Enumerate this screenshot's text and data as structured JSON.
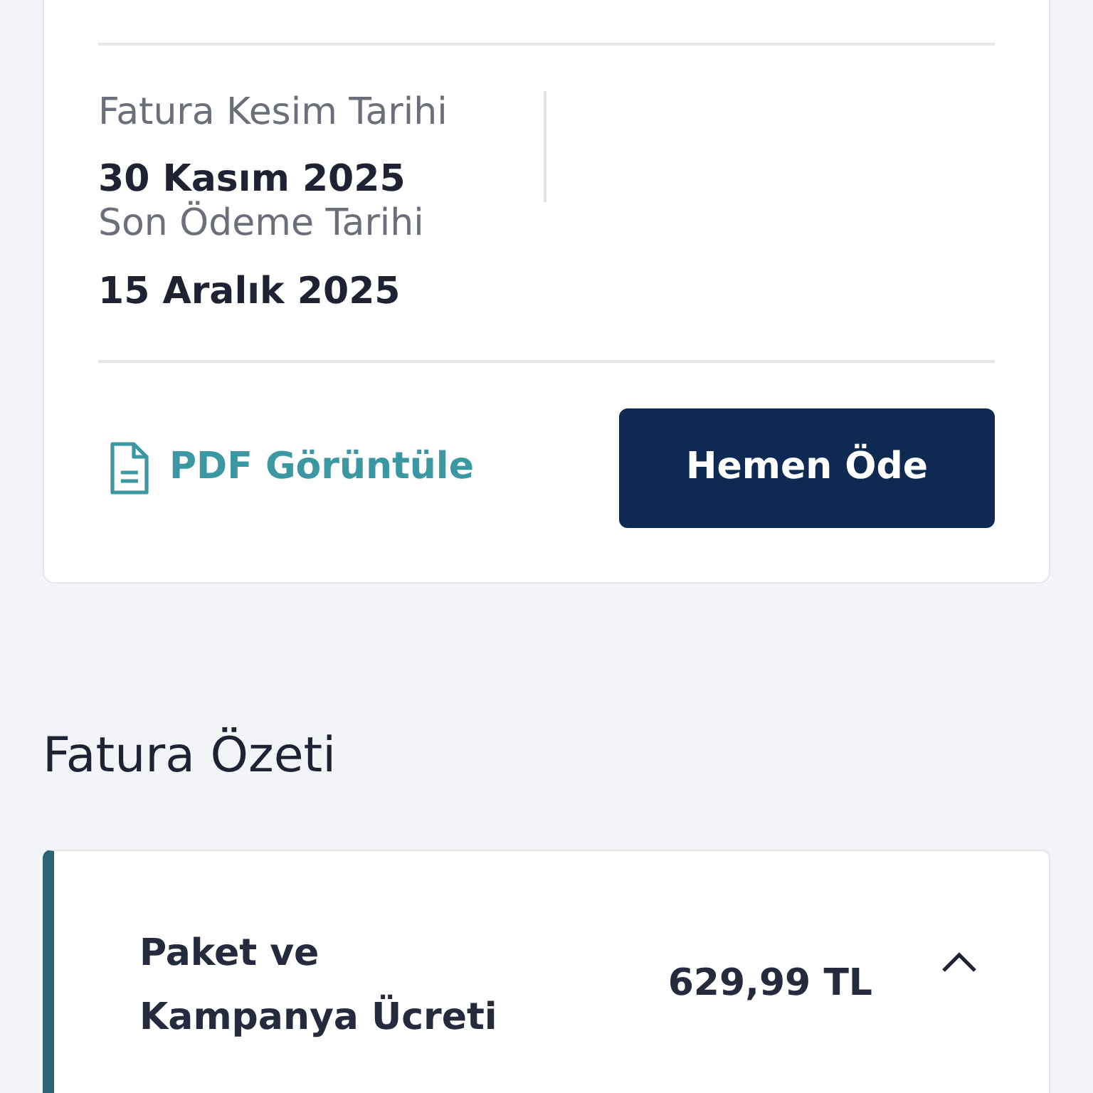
{
  "invoice_card": {
    "dates": [
      {
        "label": "Fatura Kesim Tarihi",
        "value": "30 Kasım 2025",
        "divider": true
      },
      {
        "label": "Son Ödeme Tarihi",
        "value": "15 Aralık 2025",
        "divider": false
      }
    ],
    "pdf_link": "PDF Görüntüle",
    "pay_button": "Hemen Öde"
  },
  "summary": {
    "title": "Fatura Özeti",
    "items": [
      {
        "label": "Paket ve Kampanya Ücreti",
        "amount": "629,99 TL",
        "expanded": true
      }
    ]
  }
}
